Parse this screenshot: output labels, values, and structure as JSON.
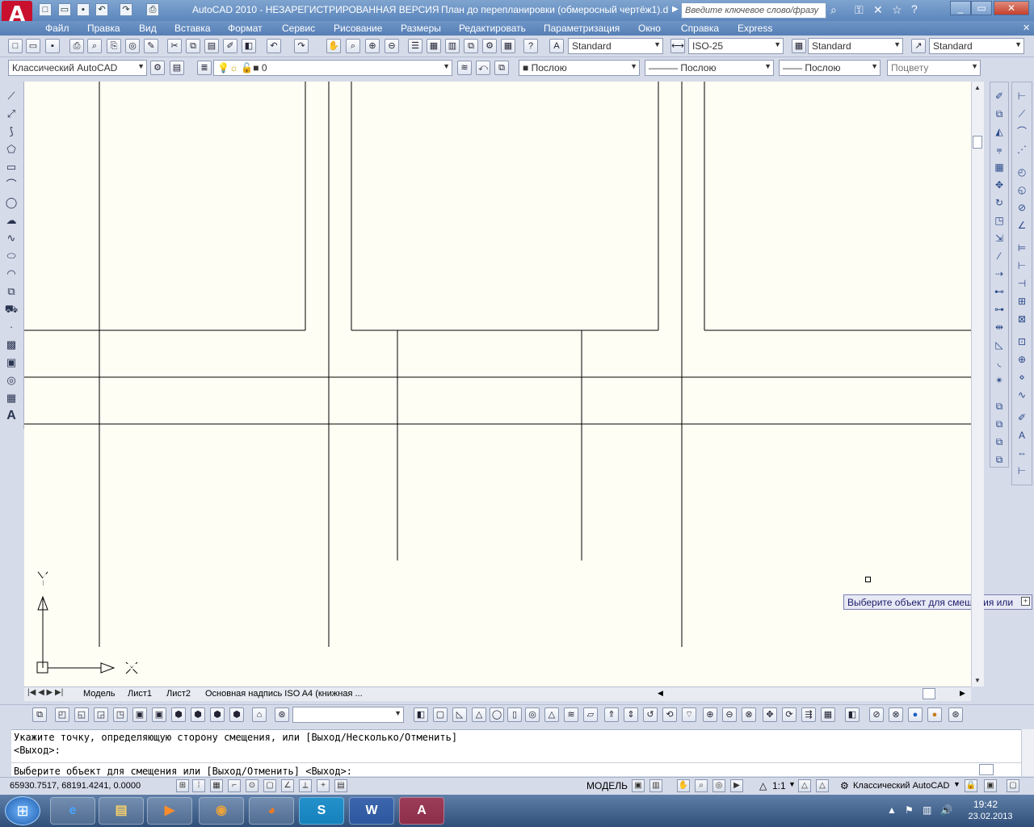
{
  "title": {
    "app": "AutoCAD 2010 - НЕЗАРЕГИСТРИРОВАННАЯ ВЕРСИЯ",
    "doc": "План до перепланировки (обмеросный чертёж1).d",
    "search_placeholder": "Введите ключевое слово/фразу"
  },
  "menu": [
    "Файл",
    "Правка",
    "Вид",
    "Вставка",
    "Формат",
    "Сервис",
    "Рисование",
    "Размеры",
    "Редактировать",
    "Параметризация",
    "Окно",
    "Справка",
    "Express"
  ],
  "toolbar1": {
    "text_style": "Standard",
    "dim_style": "ISO-25",
    "table_style": "Standard",
    "mleader_style": "Standard"
  },
  "toolbar2": {
    "workspace": "Классический AutoCAD",
    "layer": "0",
    "color": "Послою",
    "linetype": "Послою",
    "lineweight": "Послою",
    "plotstyle": "Поцвету"
  },
  "canvas": {
    "ucs_x": "X",
    "ucs_y": "Y",
    "tooltip": "Выберите объект для смещения или"
  },
  "tabs": [
    "Модель",
    "Лист1",
    "Лист2",
    "Основная надпись ISO A4 (книжная ..."
  ],
  "command": {
    "line1": "Укажите точку, определяющую сторону смещения, или [Выход/Несколько/Отменить]",
    "line2": "<Выход>:",
    "line3": "Выберите объект для смещения или [Выход/Отменить] <Выход>:"
  },
  "status": {
    "coords": "65930.7517, 68191.4241, 0.0000",
    "model": "МОДЕЛЬ",
    "scale": "1:1",
    "workspace": "Классический AutoCAD"
  },
  "taskbar": {
    "time": "19:42",
    "date": "23.02.2013"
  }
}
